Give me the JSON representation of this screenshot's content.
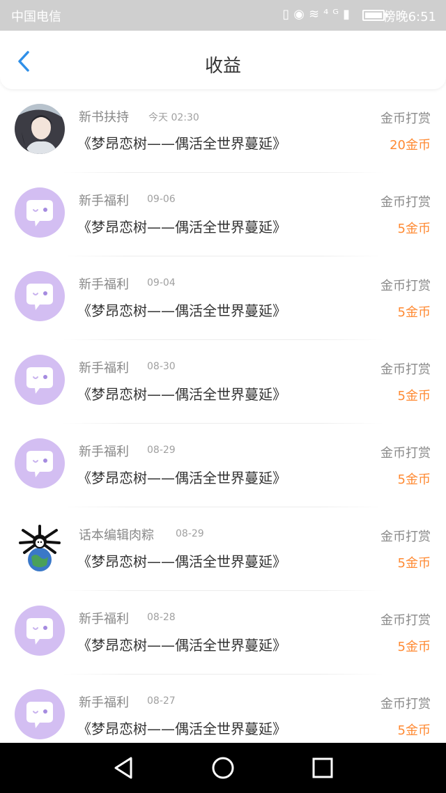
{
  "status_bar": {
    "carrier": "中国电信",
    "icons_text": "▯◉≋⁴ᴳ▮",
    "time": "傍晚6:51"
  },
  "header": {
    "title": "收益",
    "back_icon": "chevron-left-icon",
    "accent_color": "#2f8fe8"
  },
  "records": [
    {
      "name": "新书扶持",
      "date": "今天 02:30",
      "book": "《梦昂恋树——偶活全世界蔓延》",
      "tag": "金币打赏",
      "amount": "20金币",
      "avatar": "portrait"
    },
    {
      "name": "新手福利",
      "date": "09-06",
      "book": "《梦昂恋树——偶活全世界蔓延》",
      "tag": "金币打赏",
      "amount": "5金币",
      "avatar": "chat-bubble-icon"
    },
    {
      "name": "新手福利",
      "date": "09-04",
      "book": "《梦昂恋树——偶活全世界蔓延》",
      "tag": "金币打赏",
      "amount": "5金币",
      "avatar": "chat-bubble-icon"
    },
    {
      "name": "新手福利",
      "date": "08-30",
      "book": "《梦昂恋树——偶活全世界蔓延》",
      "tag": "金币打赏",
      "amount": "5金币",
      "avatar": "chat-bubble-icon"
    },
    {
      "name": "新手福利",
      "date": "08-29",
      "book": "《梦昂恋树——偶活全世界蔓延》",
      "tag": "金币打赏",
      "amount": "5金币",
      "avatar": "chat-bubble-icon"
    },
    {
      "name": "话本编辑肉粽",
      "date": "08-29",
      "book": "《梦昂恋树——偶活全世界蔓延》",
      "tag": "金币打赏",
      "amount": "5金币",
      "avatar": "cartoon-earth"
    },
    {
      "name": "新手福利",
      "date": "08-28",
      "book": "《梦昂恋树——偶活全世界蔓延》",
      "tag": "金币打赏",
      "amount": "5金币",
      "avatar": "chat-bubble-icon"
    },
    {
      "name": "新手福利",
      "date": "08-27",
      "book": "《梦昂恋树——偶活全世界蔓延》",
      "tag": "金币打赏",
      "amount": "5金币",
      "avatar": "chat-bubble-icon"
    }
  ],
  "colors": {
    "amount": "#ff8a33",
    "bubble_avatar": "#d3bef2",
    "status_bar": "#cfcfcf"
  },
  "nav_bar": {
    "back_icon": "triangle-back-icon",
    "home_icon": "circle-home-icon",
    "recents_icon": "square-recents-icon"
  }
}
